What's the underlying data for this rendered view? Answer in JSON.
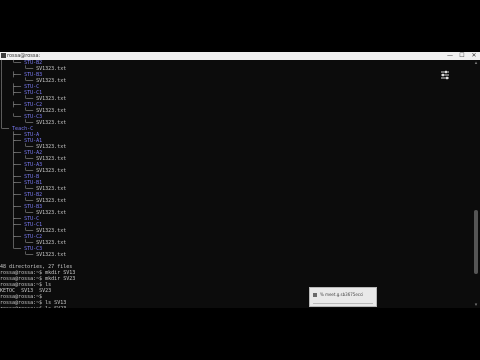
{
  "window": {
    "title": "rossa@rossa:",
    "controls": [
      "—",
      "☐",
      "✕"
    ]
  },
  "tree": [
    {
      "p": "",
      "t": "│   └── ",
      "n": "STU-B2",
      "k": "dir"
    },
    {
      "p": "",
      "t": "│       └── ",
      "n": "SV1323.txt",
      "k": "file"
    },
    {
      "p": "",
      "t": "│   ├── ",
      "n": "STU-B3",
      "k": "dir"
    },
    {
      "p": "",
      "t": "│       └── ",
      "n": "SV1323.txt",
      "k": "file"
    },
    {
      "p": "",
      "t": "│   ├── ",
      "n": "STU-C",
      "k": "dir"
    },
    {
      "p": "",
      "t": "│   ├── ",
      "n": "STU-C1",
      "k": "dir"
    },
    {
      "p": "",
      "t": "│       └── ",
      "n": "SV1323.txt",
      "k": "file"
    },
    {
      "p": "",
      "t": "│   ├── ",
      "n": "STU-C2",
      "k": "dir"
    },
    {
      "p": "",
      "t": "│       └── ",
      "n": "SV1323.txt",
      "k": "file"
    },
    {
      "p": "",
      "t": "│   └── ",
      "n": "STU-C3",
      "k": "dir"
    },
    {
      "p": "",
      "t": "│       └── ",
      "n": "SV1323.txt",
      "k": "file"
    },
    {
      "p": "",
      "t": "└── ",
      "n": "Teach-C",
      "k": "dir"
    },
    {
      "p": "",
      "t": "    ├── ",
      "n": "STU-A",
      "k": "dir"
    },
    {
      "p": "",
      "t": "    ├── ",
      "n": "STU-A1",
      "k": "dir"
    },
    {
      "p": "",
      "t": "    │   └── ",
      "n": "SV1323.txt",
      "k": "file"
    },
    {
      "p": "",
      "t": "    ├── ",
      "n": "STU-A2",
      "k": "dir"
    },
    {
      "p": "",
      "t": "    │   └── ",
      "n": "SV1323.txt",
      "k": "file"
    },
    {
      "p": "",
      "t": "    ├── ",
      "n": "STU-A3",
      "k": "dir"
    },
    {
      "p": "",
      "t": "    │   └── ",
      "n": "SV1323.txt",
      "k": "file"
    },
    {
      "p": "",
      "t": "    ├── ",
      "n": "STU-B",
      "k": "dir"
    },
    {
      "p": "",
      "t": "    ├── ",
      "n": "STU-B1",
      "k": "dir"
    },
    {
      "p": "",
      "t": "    │   └── ",
      "n": "SV1323.txt",
      "k": "file"
    },
    {
      "p": "",
      "t": "    ├── ",
      "n": "STU-B2",
      "k": "dir"
    },
    {
      "p": "",
      "t": "    │   └── ",
      "n": "SV1323.txt",
      "k": "file"
    },
    {
      "p": "",
      "t": "    ├── ",
      "n": "STU-B3",
      "k": "dir"
    },
    {
      "p": "",
      "t": "    │   └── ",
      "n": "SV1323.txt",
      "k": "file"
    },
    {
      "p": "",
      "t": "    ├── ",
      "n": "STU-C",
      "k": "dir"
    },
    {
      "p": "",
      "t": "    ├── ",
      "n": "STU-C1",
      "k": "dir"
    },
    {
      "p": "",
      "t": "    │   └── ",
      "n": "SV1323.txt",
      "k": "file"
    },
    {
      "p": "",
      "t": "    ├── ",
      "n": "STU-C2",
      "k": "dir"
    },
    {
      "p": "",
      "t": "    │   └── ",
      "n": "SV1323.txt",
      "k": "file"
    },
    {
      "p": "",
      "t": "    └── ",
      "n": "STU-C3",
      "k": "dir"
    },
    {
      "p": "",
      "t": "        └── ",
      "n": "SV1323.txt",
      "k": "file"
    }
  ],
  "output": [
    {
      "t": "",
      "k": "plain"
    },
    {
      "t": "48 directories, 27 files",
      "k": "plain"
    },
    {
      "t": "rossa@rossa:~$ mkdir SV13",
      "k": "plain"
    },
    {
      "t": "rossa@rossa:~$ mkdir SV23",
      "k": "plain"
    },
    {
      "t": "rossa@rossa:~$ ls",
      "k": "plain"
    },
    {
      "t": "KETOC  SV13  SV23",
      "k": "plain"
    },
    {
      "t": "rossa@rossa:~$",
      "k": "plain"
    },
    {
      "t": "rossa@rossa:~$ ls SV13",
      "k": "plain"
    },
    {
      "t": "rossa@rossa:~$ ls SV23",
      "k": "plain"
    },
    {
      "t": "rossa@rossa:~$",
      "k": "plain"
    }
  ],
  "toast": {
    "text": "% meet.g.sb3675ecci"
  },
  "colors": {
    "background": "#0c0c0c",
    "text": "#cccccc",
    "directory": "#7b7bf5",
    "titlebar": "#f0f0f0"
  },
  "icons": {
    "gear": "settings-sliders-icon",
    "window": "terminal-icon"
  }
}
